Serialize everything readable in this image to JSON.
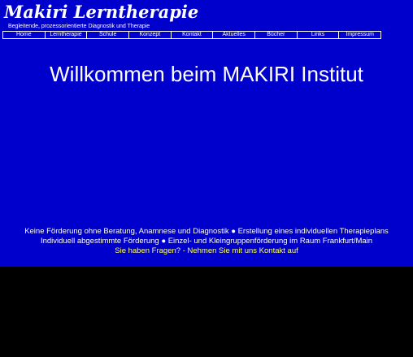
{
  "brand": {
    "title": "Makiri Lerntherapie",
    "subtitle": "Begleitende, prozessorientierte Diagnostik und Therapie"
  },
  "nav": {
    "items": [
      {
        "label": "Home"
      },
      {
        "label": "Lerntherapie"
      },
      {
        "label": "Schule"
      },
      {
        "label": "Konzept"
      },
      {
        "label": "Kontakt"
      },
      {
        "label": "Aktuelles"
      },
      {
        "label": "Bücher"
      },
      {
        "label": "Links"
      },
      {
        "label": "Impressum"
      }
    ]
  },
  "main": {
    "heading": "Willkommen beim MAKIRI Institut",
    "info_line_1": "Keine Förderung ohne Beratung, Anamnese und Diagnostik ● Erstellung eines individuellen Therapieplans",
    "info_line_2": "Individuell abgestimmte Förderung ● Einzel- und Kleingruppenförderung im Raum Frankfurt/Main",
    "contact_text": "Sie haben Fragen? - Nehmen Sie mit uns Kontakt auf"
  },
  "colors": {
    "background_blue": "#0000cc",
    "page_black": "#000000",
    "text_white": "#ffffff",
    "contact_yellow": "#ffff66"
  }
}
